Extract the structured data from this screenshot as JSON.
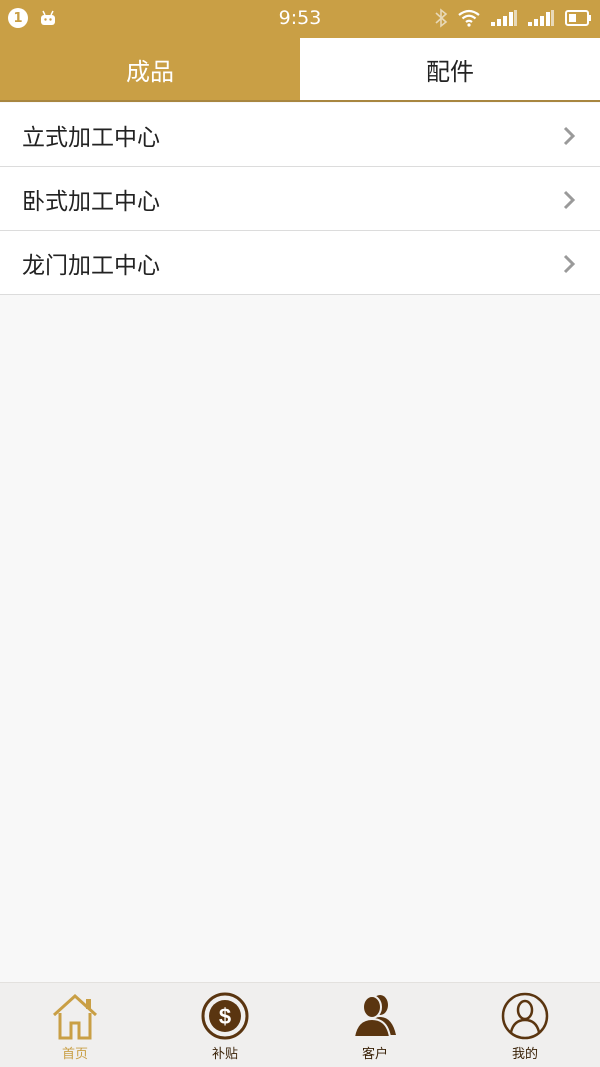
{
  "status_bar": {
    "notification_count": "1",
    "time": "9:53",
    "icons": [
      "android-icon",
      "bluetooth-icon",
      "wifi-icon",
      "signal-1-icon",
      "signal-2-icon",
      "battery-icon"
    ]
  },
  "tabs": [
    {
      "label": "成品",
      "active": true
    },
    {
      "label": "配件",
      "active": false
    }
  ],
  "list": {
    "items": [
      {
        "label": "立式加工中心",
        "icon": "chevron-right-icon"
      },
      {
        "label": "卧式加工中心",
        "icon": "chevron-right-icon"
      },
      {
        "label": "龙门加工中心",
        "icon": "chevron-right-icon"
      }
    ]
  },
  "bottom_nav": {
    "items": [
      {
        "label": "首页",
        "icon": "home-icon",
        "active": true
      },
      {
        "label": "补贴",
        "icon": "dollar-icon",
        "active": false
      },
      {
        "label": "客户",
        "icon": "customers-icon",
        "active": false
      },
      {
        "label": "我的",
        "icon": "profile-icon",
        "active": false
      }
    ]
  },
  "colors": {
    "accent": "#c99f45",
    "nav_dark": "#5a3510",
    "background": "#f8f8f8"
  }
}
